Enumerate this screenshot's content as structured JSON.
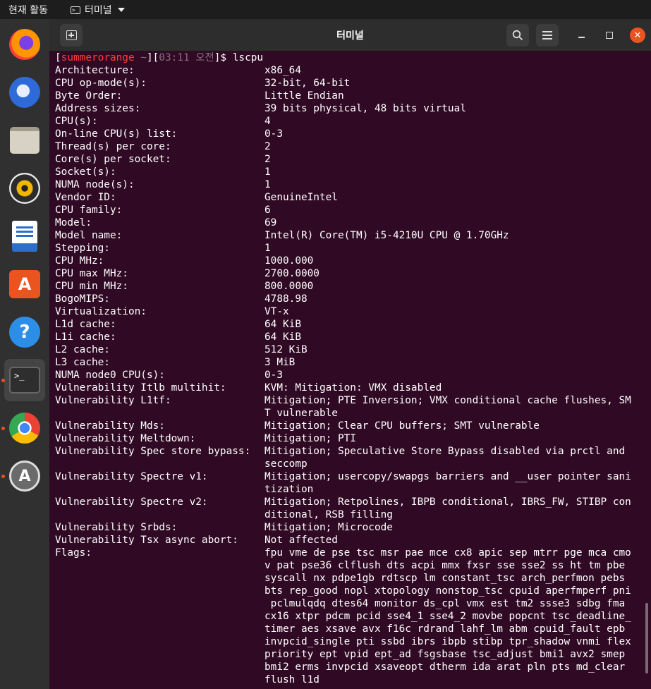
{
  "topbar": {
    "activities": "현재 활동",
    "app_name": "터미널"
  },
  "window": {
    "title": "터미널"
  },
  "dock": {
    "apps": [
      "firefox-icon",
      "thunderbird-icon",
      "files-icon",
      "rhythmbox-icon",
      "libreoffice-writer-icon",
      "app-center-icon",
      "help-icon",
      "terminal-icon",
      "chrome-icon",
      "software-updater-icon"
    ]
  },
  "terminal": {
    "prompt": {
      "open": "[",
      "user": "summerorange",
      "path": " ~",
      "mid": "][",
      "time": "03:11 오전",
      "close": "]$ ",
      "command": "lscpu"
    },
    "lines": [
      {
        "k": "Architecture:",
        "v": [
          "x86_64"
        ]
      },
      {
        "k": "CPU op-mode(s):",
        "v": [
          "32-bit, 64-bit"
        ]
      },
      {
        "k": "Byte Order:",
        "v": [
          "Little Endian"
        ]
      },
      {
        "k": "Address sizes:",
        "v": [
          "39 bits physical, 48 bits virtual"
        ]
      },
      {
        "k": "CPU(s):",
        "v": [
          "4"
        ]
      },
      {
        "k": "On-line CPU(s) list:",
        "v": [
          "0-3"
        ]
      },
      {
        "k": "Thread(s) per core:",
        "v": [
          "2"
        ]
      },
      {
        "k": "Core(s) per socket:",
        "v": [
          "2"
        ]
      },
      {
        "k": "Socket(s):",
        "v": [
          "1"
        ]
      },
      {
        "k": "NUMA node(s):",
        "v": [
          "1"
        ]
      },
      {
        "k": "Vendor ID:",
        "v": [
          "GenuineIntel"
        ]
      },
      {
        "k": "CPU family:",
        "v": [
          "6"
        ]
      },
      {
        "k": "Model:",
        "v": [
          "69"
        ]
      },
      {
        "k": "Model name:",
        "v": [
          "Intel(R) Core(TM) i5-4210U CPU @ 1.70GHz"
        ]
      },
      {
        "k": "Stepping:",
        "v": [
          "1"
        ]
      },
      {
        "k": "CPU MHz:",
        "v": [
          "1000.000"
        ]
      },
      {
        "k": "CPU max MHz:",
        "v": [
          "2700.0000"
        ]
      },
      {
        "k": "CPU min MHz:",
        "v": [
          "800.0000"
        ]
      },
      {
        "k": "BogoMIPS:",
        "v": [
          "4788.98"
        ]
      },
      {
        "k": "Virtualization:",
        "v": [
          "VT-x"
        ]
      },
      {
        "k": "L1d cache:",
        "v": [
          "64 KiB"
        ]
      },
      {
        "k": "L1i cache:",
        "v": [
          "64 KiB"
        ]
      },
      {
        "k": "L2 cache:",
        "v": [
          "512 KiB"
        ]
      },
      {
        "k": "L3 cache:",
        "v": [
          "3 MiB"
        ]
      },
      {
        "k": "NUMA node0 CPU(s):",
        "v": [
          "0-3"
        ]
      },
      {
        "k": "Vulnerability Itlb multihit:",
        "v": [
          "KVM: Mitigation: VMX disabled"
        ]
      },
      {
        "k": "Vulnerability L1tf:",
        "v": [
          "Mitigation; PTE Inversion; VMX conditional cache flushes, SM",
          "T vulnerable"
        ]
      },
      {
        "k": "Vulnerability Mds:",
        "v": [
          "Mitigation; Clear CPU buffers; SMT vulnerable"
        ]
      },
      {
        "k": "Vulnerability Meltdown:",
        "v": [
          "Mitigation; PTI"
        ]
      },
      {
        "k": "Vulnerability Spec store bypass:",
        "v": [
          "Mitigation; Speculative Store Bypass disabled via prctl and",
          "seccomp"
        ]
      },
      {
        "k": "Vulnerability Spectre v1:",
        "v": [
          "Mitigation; usercopy/swapgs barriers and __user pointer sani",
          "tization"
        ]
      },
      {
        "k": "Vulnerability Spectre v2:",
        "v": [
          "Mitigation; Retpolines, IBPB conditional, IBRS_FW, STIBP con",
          "ditional, RSB filling"
        ]
      },
      {
        "k": "Vulnerability Srbds:",
        "v": [
          "Mitigation; Microcode"
        ]
      },
      {
        "k": "Vulnerability Tsx async abort:",
        "v": [
          "Not affected"
        ]
      },
      {
        "k": "Flags:",
        "v": [
          "fpu vme de pse tsc msr pae mce cx8 apic sep mtrr pge mca cmo",
          "v pat pse36 clflush dts acpi mmx fxsr sse sse2 ss ht tm pbe",
          "syscall nx pdpe1gb rdtscp lm constant_tsc arch_perfmon pebs",
          "bts rep_good nopl xtopology nonstop_tsc cpuid aperfmperf pni",
          " pclmulqdq dtes64 monitor ds_cpl vmx est tm2 ssse3 sdbg fma",
          "cx16 xtpr pdcm pcid sse4_1 sse4_2 movbe popcnt tsc_deadline_",
          "timer aes xsave avx f16c rdrand lahf_lm abm cpuid_fault epb",
          "invpcid_single pti ssbd ibrs ibpb stibp tpr_shadow vnmi flex",
          "priority ept vpid ept_ad fsgsbase tsc_adjust bmi1 avx2 smep",
          "bmi2 erms invpcid xsaveopt dtherm ida arat pln pts md_clear",
          "flush l1d"
        ]
      }
    ]
  }
}
